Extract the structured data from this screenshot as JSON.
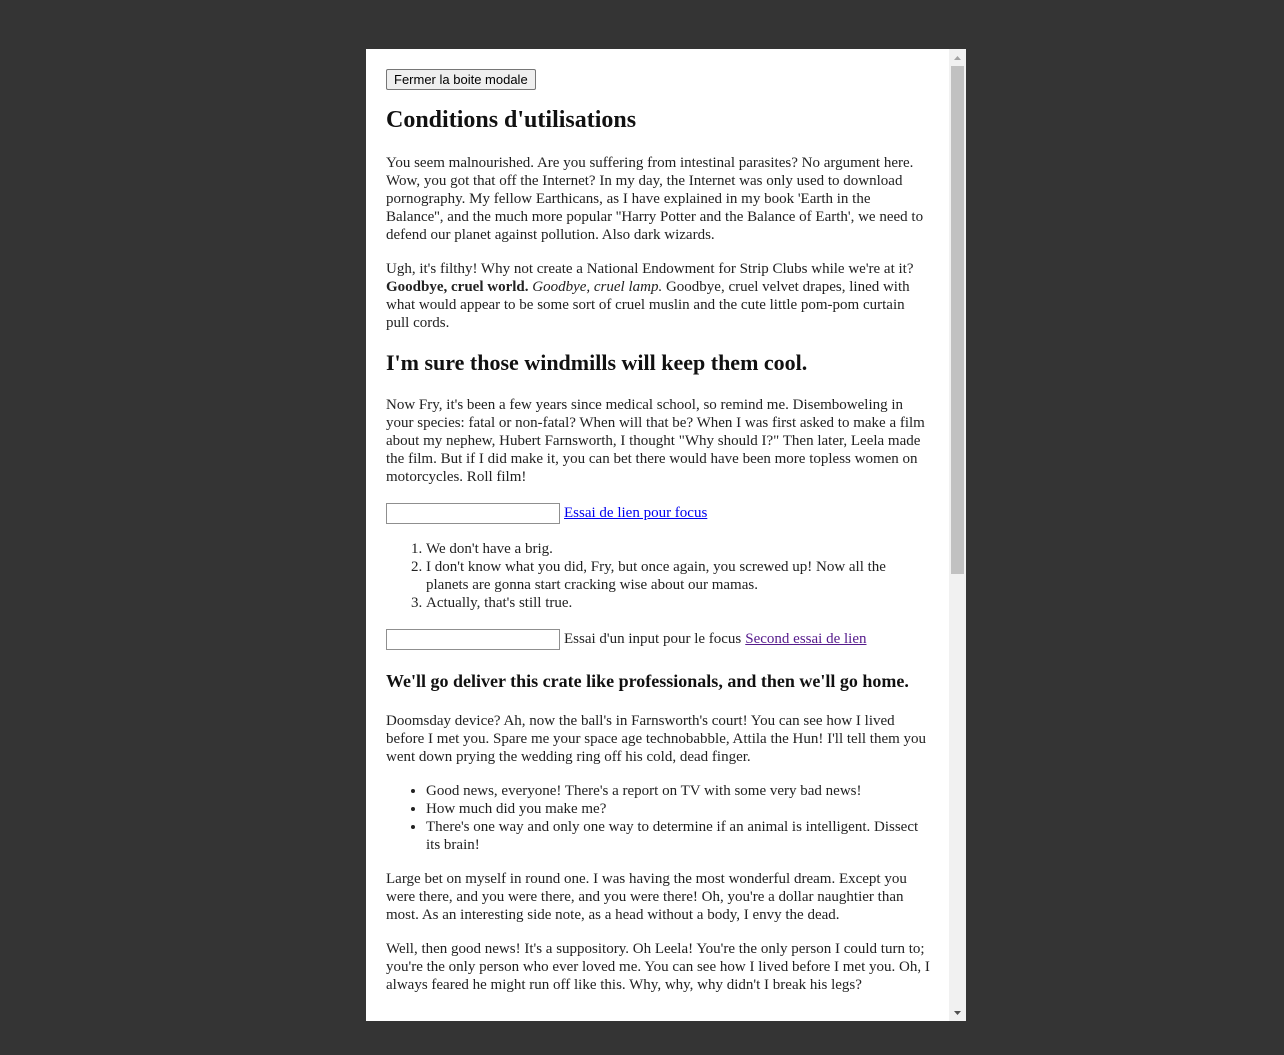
{
  "modal": {
    "close_label": "Fermer la boite modale",
    "heading1": "Conditions d'utilisations",
    "para1": "You seem malnourished. Are you suffering from intestinal parasites? No argument here. Wow, you got that off the Internet? In my day, the Internet was only used to download pornography. My fellow Earthicans, as I have explained in my book 'Earth in the Balance'', and the much more popular ''Harry Potter and the Balance of Earth', we need to defend our planet against pollution. Also dark wizards.",
    "para2_start": "Ugh, it's filthy! Why not create a National Endowment for Strip Clubs while we're at it? ",
    "para2_bold": "Goodbye, cruel world.",
    "para2_italic": "Goodbye, cruel lamp.",
    "para2_end": " Goodbye, cruel velvet drapes, lined with what would appear to be some sort of cruel muslin and the cute little pom-pom curtain pull cords.",
    "heading2": "I'm sure those windmills will keep them cool.",
    "para3": "Now Fry, it's been a few years since medical school, so remind me. Disemboweling in your species: fatal or non-fatal? When will that be? When I was first asked to make a film about my nephew, Hubert Farnsworth, I thought \"Why should I?\" Then later, Leela made the film. But if I did make it, you can bet there would have been more topless women on motorcycles. Roll film!",
    "link1": "Essai de lien pour focus",
    "ordered_list": [
      "We don't have a brig.",
      "I don't know what you did, Fry, but once again, you screwed up! Now all the planets are gonna start cracking wise about our mamas.",
      "Actually, that's still true."
    ],
    "input2_label": "Essai d'un input pour le focus",
    "link2": "Second essai de lien",
    "heading3": "We'll go deliver this crate like professionals, and then we'll go home.",
    "para4": "Doomsday device? Ah, now the ball's in Farnsworth's court! You can see how I lived before I met you. Spare me your space age technobabble, Attila the Hun! I'll tell them you went down prying the wedding ring off his cold, dead finger.",
    "unordered_list": [
      "Good news, everyone! There's a report on TV with some very bad news!",
      "How much did you make me?",
      "There's one way and only one way to determine if an animal is intelligent. Dissect its brain!"
    ],
    "para5": "Large bet on myself in round one. I was having the most wonderful dream. Except you were there, and you were there, and you were there! Oh, you're a dollar naughtier than most. As an interesting side note, as a head without a body, I envy the dead.",
    "para6": "Well, then good news! It's a suppository. Oh Leela! You're the only person I could turn to; you're the only person who ever loved me. You can see how I lived before I met you. Oh, I always feared he might run off like this. Why, why, why didn't I break his legs?"
  },
  "colors": {
    "backdrop": "#343434",
    "link": "#0000ee",
    "visited_link": "#551a8b"
  },
  "icons": {
    "scroll_up": "triangle-up-icon",
    "scroll_down": "triangle-down-icon"
  }
}
